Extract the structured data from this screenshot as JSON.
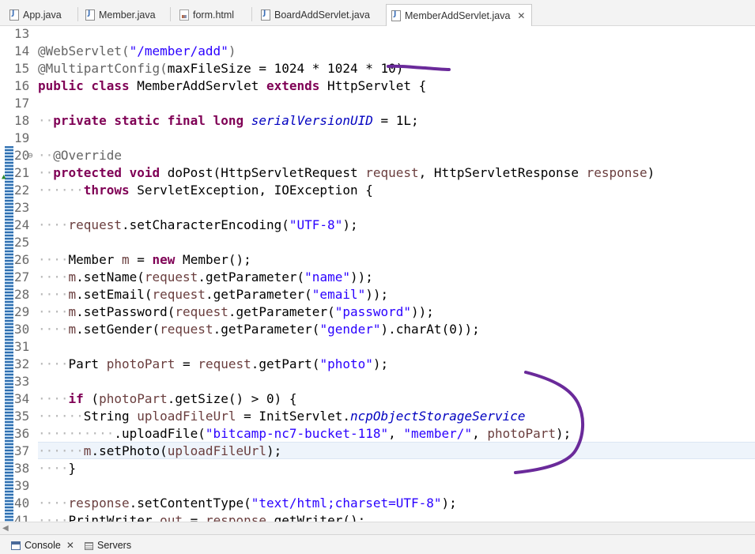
{
  "tabs": [
    {
      "label": "App.java",
      "type": "java",
      "active": false
    },
    {
      "label": "Member.java",
      "type": "java",
      "active": false
    },
    {
      "label": "form.html",
      "type": "html",
      "active": false
    },
    {
      "label": "BoardAddServlet.java",
      "type": "java",
      "active": false
    },
    {
      "label": "MemberAddServlet.java",
      "type": "java",
      "active": true
    }
  ],
  "tab_close_glyph": "✕",
  "editor": {
    "lines": [
      {
        "n": "13",
        "segs": []
      },
      {
        "n": "14",
        "segs": [
          {
            "t": "@WebServlet(",
            "c": "annot"
          },
          {
            "t": "\"/member/add\"",
            "c": "str"
          },
          {
            "t": ")",
            "c": "annot"
          }
        ]
      },
      {
        "n": "15",
        "segs": [
          {
            "t": "@MultipartConfig(",
            "c": "annot"
          },
          {
            "t": "maxFileSize = 1024 * 1024 * 10)",
            "c": ""
          }
        ]
      },
      {
        "n": "16",
        "segs": [
          {
            "t": "public class",
            "c": "kw"
          },
          {
            "t": " MemberAddServlet ",
            "c": ""
          },
          {
            "t": "extends",
            "c": "kw"
          },
          {
            "t": " HttpServlet {",
            "c": ""
          }
        ]
      },
      {
        "n": "17",
        "segs": []
      },
      {
        "n": "18",
        "segs": [
          {
            "t": "··",
            "c": "ws"
          },
          {
            "t": "private static final long",
            "c": "kw"
          },
          {
            "t": " ",
            "c": ""
          },
          {
            "t": "serialVersionUID",
            "c": "stat"
          },
          {
            "t": " = 1L;",
            "c": ""
          }
        ]
      },
      {
        "n": "19",
        "segs": []
      },
      {
        "n": "20",
        "fold": "⊖",
        "segs": [
          {
            "t": "··",
            "c": "ws"
          },
          {
            "t": "@Override",
            "c": "annot"
          }
        ]
      },
      {
        "n": "21",
        "override": "▲",
        "segs": [
          {
            "t": "··",
            "c": "ws"
          },
          {
            "t": "protected void",
            "c": "kw"
          },
          {
            "t": " doPost(HttpServletRequest ",
            "c": ""
          },
          {
            "t": "request",
            "c": "var"
          },
          {
            "t": ", HttpServletResponse ",
            "c": ""
          },
          {
            "t": "response",
            "c": "var"
          },
          {
            "t": ")",
            "c": ""
          }
        ]
      },
      {
        "n": "22",
        "segs": [
          {
            "t": "······",
            "c": "ws"
          },
          {
            "t": "throws",
            "c": "kw"
          },
          {
            "t": " ServletException, IOException {",
            "c": ""
          }
        ]
      },
      {
        "n": "23",
        "segs": []
      },
      {
        "n": "24",
        "segs": [
          {
            "t": "····",
            "c": "ws"
          },
          {
            "t": "request",
            "c": "var"
          },
          {
            "t": ".setCharacterEncoding(",
            "c": ""
          },
          {
            "t": "\"UTF-8\"",
            "c": "str"
          },
          {
            "t": ");",
            "c": ""
          }
        ]
      },
      {
        "n": "25",
        "segs": []
      },
      {
        "n": "26",
        "segs": [
          {
            "t": "····",
            "c": "ws"
          },
          {
            "t": "Member ",
            "c": ""
          },
          {
            "t": "m",
            "c": "var"
          },
          {
            "t": " = ",
            "c": ""
          },
          {
            "t": "new",
            "c": "kw"
          },
          {
            "t": " Member();",
            "c": ""
          }
        ]
      },
      {
        "n": "27",
        "segs": [
          {
            "t": "····",
            "c": "ws"
          },
          {
            "t": "m",
            "c": "var"
          },
          {
            "t": ".setName(",
            "c": ""
          },
          {
            "t": "request",
            "c": "var"
          },
          {
            "t": ".getParameter(",
            "c": ""
          },
          {
            "t": "\"name\"",
            "c": "str"
          },
          {
            "t": "));",
            "c": ""
          }
        ]
      },
      {
        "n": "28",
        "segs": [
          {
            "t": "····",
            "c": "ws"
          },
          {
            "t": "m",
            "c": "var"
          },
          {
            "t": ".setEmail(",
            "c": ""
          },
          {
            "t": "request",
            "c": "var"
          },
          {
            "t": ".getParameter(",
            "c": ""
          },
          {
            "t": "\"email\"",
            "c": "str"
          },
          {
            "t": "));",
            "c": ""
          }
        ]
      },
      {
        "n": "29",
        "segs": [
          {
            "t": "····",
            "c": "ws"
          },
          {
            "t": "m",
            "c": "var"
          },
          {
            "t": ".setPassword(",
            "c": ""
          },
          {
            "t": "request",
            "c": "var"
          },
          {
            "t": ".getParameter(",
            "c": ""
          },
          {
            "t": "\"password\"",
            "c": "str"
          },
          {
            "t": "));",
            "c": ""
          }
        ]
      },
      {
        "n": "30",
        "segs": [
          {
            "t": "····",
            "c": "ws"
          },
          {
            "t": "m",
            "c": "var"
          },
          {
            "t": ".setGender(",
            "c": ""
          },
          {
            "t": "request",
            "c": "var"
          },
          {
            "t": ".getParameter(",
            "c": ""
          },
          {
            "t": "\"gender\"",
            "c": "str"
          },
          {
            "t": ").charAt(0));",
            "c": ""
          }
        ]
      },
      {
        "n": "31",
        "segs": []
      },
      {
        "n": "32",
        "segs": [
          {
            "t": "····",
            "c": "ws"
          },
          {
            "t": "Part ",
            "c": ""
          },
          {
            "t": "photoPart",
            "c": "var"
          },
          {
            "t": " = ",
            "c": ""
          },
          {
            "t": "request",
            "c": "var"
          },
          {
            "t": ".getPart(",
            "c": ""
          },
          {
            "t": "\"photo\"",
            "c": "str"
          },
          {
            "t": ");",
            "c": ""
          }
        ]
      },
      {
        "n": "33",
        "segs": []
      },
      {
        "n": "34",
        "segs": [
          {
            "t": "····",
            "c": "ws"
          },
          {
            "t": "if",
            "c": "kw"
          },
          {
            "t": " (",
            "c": ""
          },
          {
            "t": "photoPart",
            "c": "var"
          },
          {
            "t": ".getSize() > 0) {",
            "c": ""
          }
        ]
      },
      {
        "n": "35",
        "segs": [
          {
            "t": "······",
            "c": "ws"
          },
          {
            "t": "String ",
            "c": ""
          },
          {
            "t": "uploadFileUrl",
            "c": "var"
          },
          {
            "t": " = InitServlet.",
            "c": ""
          },
          {
            "t": "ncpObjectStorageService",
            "c": "stat"
          }
        ]
      },
      {
        "n": "36",
        "segs": [
          {
            "t": "··········",
            "c": "ws"
          },
          {
            "t": ".uploadFile(",
            "c": ""
          },
          {
            "t": "\"bitcamp-nc7-bucket-118\"",
            "c": "str"
          },
          {
            "t": ", ",
            "c": ""
          },
          {
            "t": "\"member/\"",
            "c": "str"
          },
          {
            "t": ", ",
            "c": ""
          },
          {
            "t": "photoPart",
            "c": "var"
          },
          {
            "t": ");",
            "c": ""
          }
        ]
      },
      {
        "n": "37",
        "segs": [
          {
            "t": "······",
            "c": "ws"
          },
          {
            "t": "m",
            "c": "var"
          },
          {
            "t": ".setPhoto(",
            "c": ""
          },
          {
            "t": "uploadFileUrl",
            "c": "var"
          },
          {
            "t": ");",
            "c": ""
          }
        ]
      },
      {
        "n": "38",
        "segs": [
          {
            "t": "····",
            "c": "ws"
          },
          {
            "t": "}",
            "c": ""
          }
        ]
      },
      {
        "n": "39",
        "segs": []
      },
      {
        "n": "40",
        "segs": [
          {
            "t": "····",
            "c": "ws"
          },
          {
            "t": "response",
            "c": "var"
          },
          {
            "t": ".setContentType(",
            "c": ""
          },
          {
            "t": "\"text/html;charset=UTF-8\"",
            "c": "str"
          },
          {
            "t": ");",
            "c": ""
          }
        ]
      },
      {
        "n": "41",
        "segs": [
          {
            "t": "····",
            "c": "ws"
          },
          {
            "t": "PrintWriter ",
            "c": ""
          },
          {
            "t": "out",
            "c": "var"
          },
          {
            "t": " = ",
            "c": ""
          },
          {
            "t": "response",
            "c": "var"
          },
          {
            "t": ".getWriter();",
            "c": ""
          }
        ]
      }
    ]
  },
  "bottom_tabs": {
    "console_label": "Console",
    "console_close": "✕",
    "servers_label": "Servers"
  },
  "colors": {
    "annotation": "#646464",
    "keyword": "#7f0055",
    "string": "#2a00ff",
    "static_field": "#0000c0",
    "local_variable": "#6a3e3e",
    "pen_marks": "#6a2a9a"
  }
}
